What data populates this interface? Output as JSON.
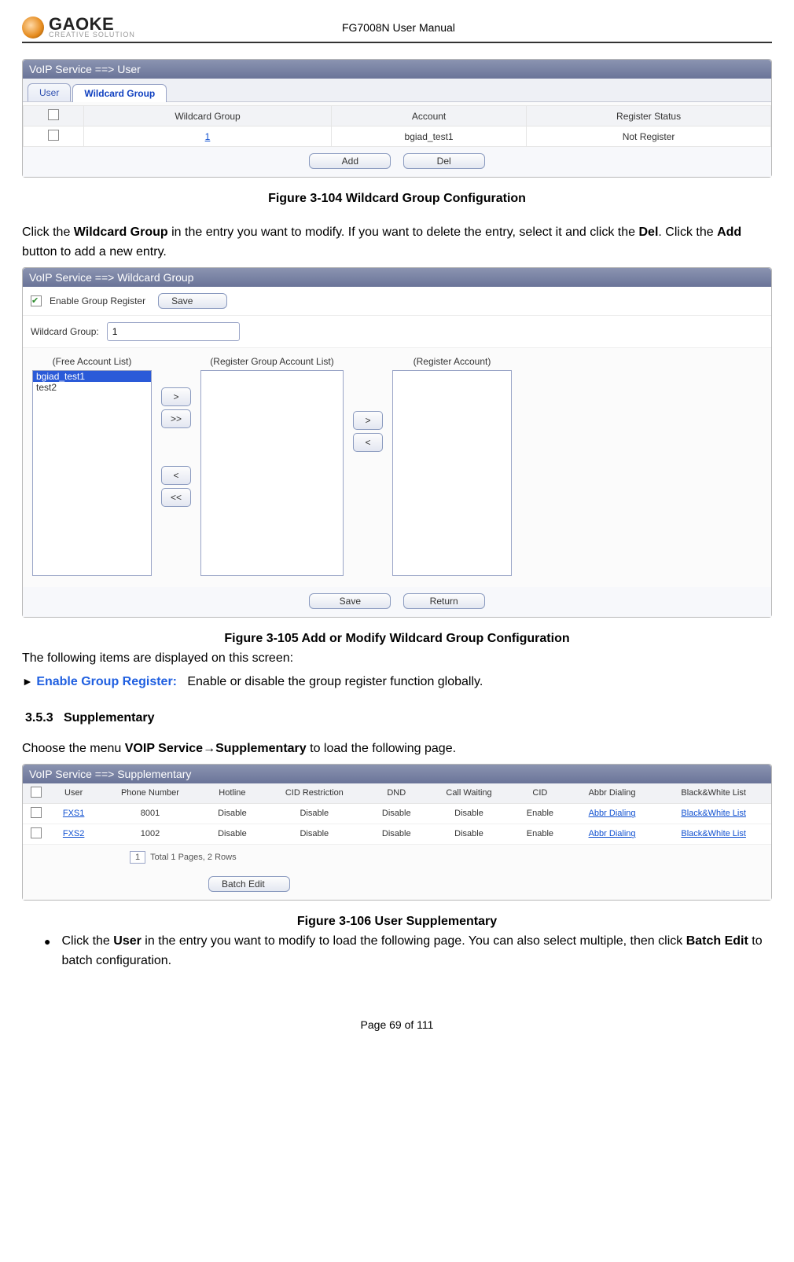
{
  "doc": {
    "brand": "GAOKE",
    "brand_sub": "CREATIVE SOLUTION",
    "title": "FG7008N User Manual",
    "footer": "Page 69 of 111"
  },
  "fig1": {
    "crumb": "VoIP Service ==> User",
    "tabs": [
      "User",
      "Wildcard Group"
    ],
    "active_tab": 1,
    "headers": [
      "",
      "Wildcard Group",
      "Account",
      "Register Status"
    ],
    "row": {
      "wg": "1",
      "acct": "bgiad_test1",
      "status": "Not Register"
    },
    "btn_add": "Add",
    "btn_del": "Del",
    "caption": "Figure 3-104 Wildcard Group Configuration"
  },
  "para1_a": "Click the ",
  "para1_b": "Wildcard Group",
  "para1_c": " in the entry you want to modify. If you want to delete the entry, select it and click the ",
  "para1_d": "Del",
  "para1_e": ". Click the ",
  "para1_f": "Add",
  "para1_g": " button to add a new entry.",
  "fig2": {
    "crumb": "VoIP Service ==> Wildcard Group",
    "enable_label": "Enable Group Register",
    "save": "Save",
    "wg_label": "Wildcard Group:",
    "wg_value": "1",
    "col1": "(Free Account List)",
    "col2": "(Register Group Account List)",
    "col3": "(Register Account)",
    "free_items": [
      "bgiad_test1",
      "test2"
    ],
    "btn_save": "Save",
    "btn_return": "Return",
    "caption": "Figure 3-105 Add or Modify Wildcard Group Configuration"
  },
  "para2": "The following items are displayed on this screen:",
  "enable_item_label": "Enable Group Register:",
  "enable_item_desc": "Enable or disable the group register function globally.",
  "section": {
    "num": "3.5.3",
    "title": "Supplementary"
  },
  "para3_a": "Choose the menu ",
  "para3_b": "VOIP Service→Supplementary",
  "para3_c": " to load the following page.",
  "fig3": {
    "crumb": "VoIP Service ==> Supplementary",
    "headers": [
      "",
      "User",
      "Phone Number",
      "Hotline",
      "CID Restriction",
      "DND",
      "Call Waiting",
      "CID",
      "Abbr Dialing",
      "Black&White List"
    ],
    "rows": [
      {
        "user": "FXS1",
        "pn": "8001",
        "hot": "Disable",
        "cidr": "Disable",
        "dnd": "Disable",
        "cw": "Disable",
        "cid": "Enable",
        "ab": "Abbr Dialing",
        "bw": "Black&White List"
      },
      {
        "user": "FXS2",
        "pn": "1002",
        "hot": "Disable",
        "cidr": "Disable",
        "dnd": "Disable",
        "cw": "Disable",
        "cid": "Enable",
        "ab": "Abbr Dialing",
        "bw": "Black&White List"
      }
    ],
    "pager_text": "Total 1 Pages, 2 Rows",
    "pager_value": "1",
    "batch": "Batch Edit",
    "caption": "Figure 3-106 User Supplementary"
  },
  "bullet_a": "Click the ",
  "bullet_b": "User",
  "bullet_c": " in the entry you want to modify to load the following page. You can also select multiple, then click ",
  "bullet_d": "Batch Edit",
  "bullet_e": " to batch configuration."
}
